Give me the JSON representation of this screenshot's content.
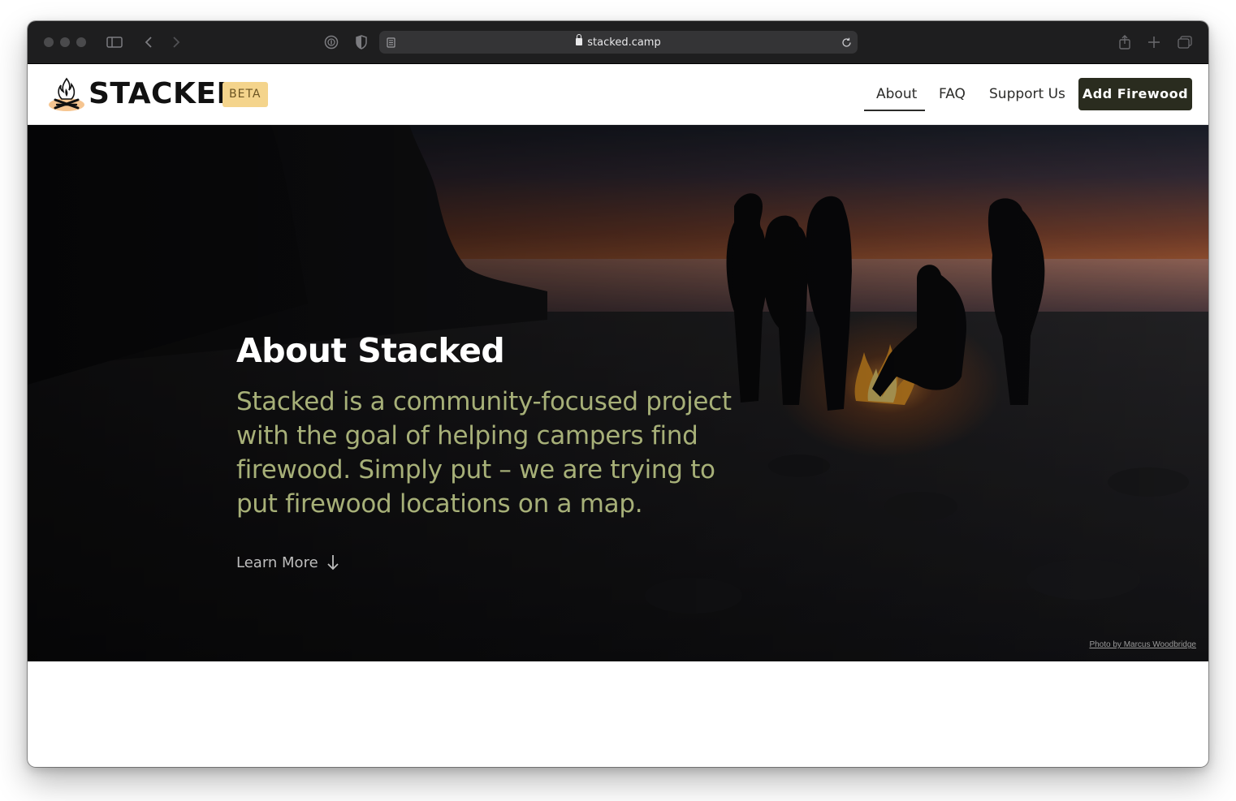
{
  "browser": {
    "url": "stacked.camp",
    "icons": [
      "sidebar-icon",
      "back-icon",
      "forward-icon",
      "password-icon",
      "shield-icon",
      "reader-icon",
      "reload-icon",
      "share-icon",
      "new-tab-icon",
      "tab-overview-icon"
    ]
  },
  "site": {
    "brand": "STACKED",
    "badge": "BETA",
    "nav": {
      "about": "About",
      "faq": "FAQ",
      "support": "Support Us",
      "active": "About"
    },
    "cta": "Add Firewood"
  },
  "hero": {
    "title": "About Stacked",
    "description": "Stacked is a community-focused project with the goal of helping campers find firewood. Simply put  – we are trying to put firewood locations on a map.",
    "learn_more": "Learn More",
    "credit": "Photo by Marcus Woodbridge"
  },
  "colors": {
    "accent": "#2a2c1f",
    "badge": "#f4d48c",
    "description": "#a7b078"
  }
}
